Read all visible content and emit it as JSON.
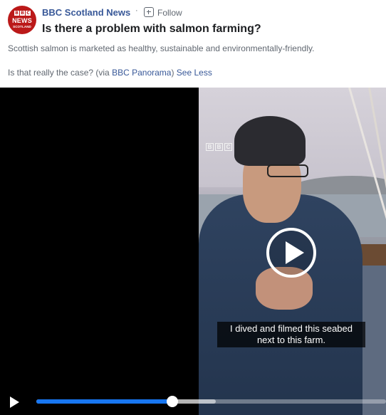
{
  "post": {
    "page_name": "BBC Scotland News",
    "separator": "·",
    "follow_label": "Follow",
    "headline": "Is there a problem with salmon farming?",
    "description_line1": "Scottish salmon is marketed as healthy, sustainable and environmentally-friendly.",
    "description_line2_prefix": "Is that really the case? (via ",
    "description_link": "BBC Panorama",
    "description_line2_suffix": ")",
    "see_less": "See Less"
  },
  "avatar": {
    "blocks": [
      "B",
      "B",
      "C"
    ],
    "news": "NEWS",
    "region": "SCOTLAND",
    "color": "#bb1919"
  },
  "video": {
    "watermark": [
      "B",
      "B",
      "C"
    ],
    "caption_line1": "I dived and filmed this seabed",
    "caption_line2": "next to this farm.",
    "progress_fraction": 0.39,
    "accent_color": "#1877f2"
  },
  "icons": {
    "follow": "follow-plus-icon",
    "play": "play-icon"
  }
}
